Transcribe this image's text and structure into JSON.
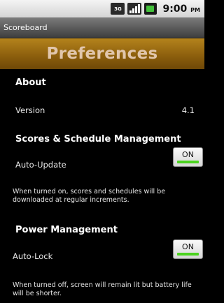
{
  "status_bar": {
    "network_label": "3G",
    "time": "9:00",
    "ampm": "PM",
    "icons": [
      "network-3g-icon",
      "signal-icon",
      "battery-icon"
    ],
    "battery_color": "#43c13b"
  },
  "app_title": "Scoreboard",
  "banner_title": "Preferences",
  "colors": {
    "banner": "#8a5d0c",
    "banner_text": "#e1c6ac",
    "toggle_on": "#4bd31f"
  },
  "sections": {
    "about": {
      "header": "About",
      "version_label": "Version",
      "version_value": "4.1"
    },
    "scores": {
      "header": "Scores & Schedule Management",
      "auto_update_label": "Auto-Update",
      "auto_update_state": "ON",
      "note": "When turned on, scores and schedules will be downloaded at regular increments."
    },
    "power": {
      "header": "Power Management",
      "auto_lock_label": "Auto-Lock",
      "auto_lock_state": "ON",
      "note": "When turned off, screen will remain lit but battery life will be shorter."
    }
  }
}
